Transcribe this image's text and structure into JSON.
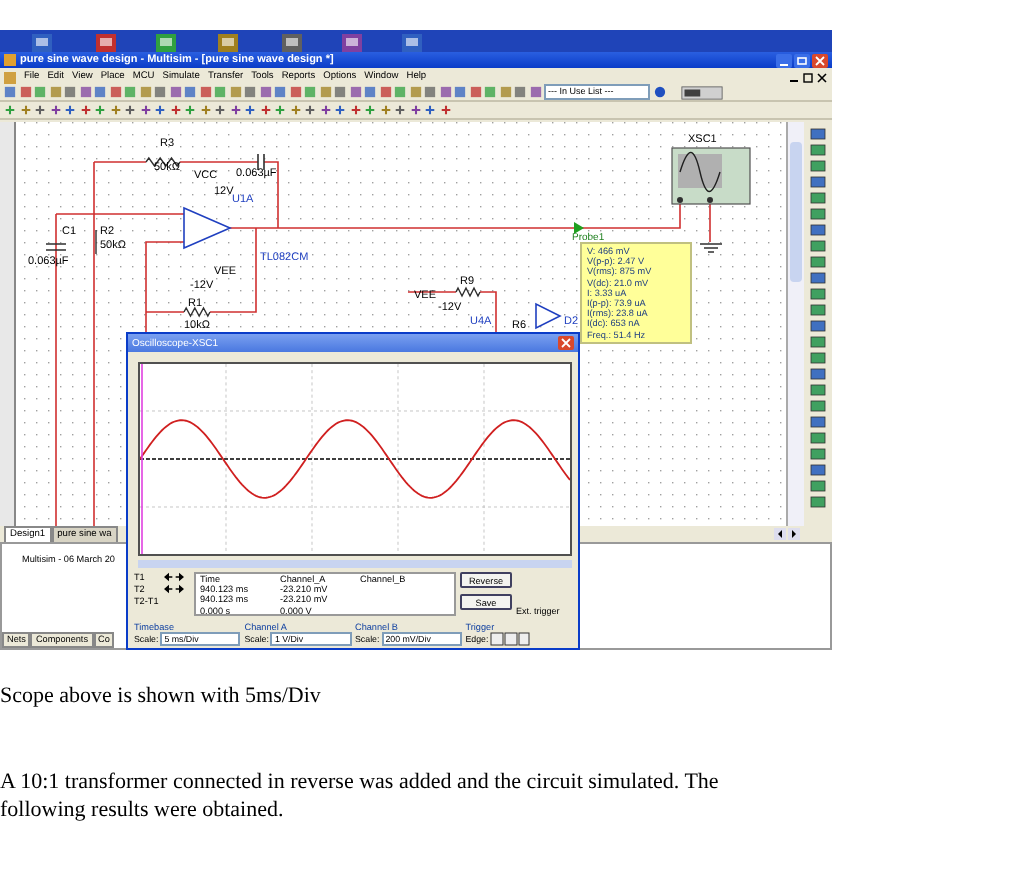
{
  "window": {
    "title": "pure sine wave design - Multisim - [pure sine wave design *]"
  },
  "menu": [
    "File",
    "Edit",
    "View",
    "Place",
    "MCU",
    "Simulate",
    "Transfer",
    "Tools",
    "Reports",
    "Options",
    "Window",
    "Help"
  ],
  "toolbar": {
    "in_use_list": "--- In Use List ---"
  },
  "circuit": {
    "labels": [
      {
        "text": "R3",
        "kind": "ref"
      },
      {
        "text": "50kΩ",
        "kind": "value"
      },
      {
        "text": "0.063µF",
        "kind": "value"
      },
      {
        "text": "VCC",
        "kind": "ref"
      },
      {
        "text": "12V",
        "kind": "value"
      },
      {
        "text": "U1A",
        "kind": "part"
      },
      {
        "text": "C1",
        "kind": "ref"
      },
      {
        "text": "0.063µF",
        "kind": "value"
      },
      {
        "text": "R2",
        "kind": "ref"
      },
      {
        "text": "50kΩ",
        "kind": "value"
      },
      {
        "text": "TL082CM",
        "kind": "part"
      },
      {
        "text": "VEE",
        "kind": "ref"
      },
      {
        "text": "-12V",
        "kind": "value"
      },
      {
        "text": "R1",
        "kind": "ref"
      },
      {
        "text": "10kΩ",
        "kind": "value"
      },
      {
        "text": "VEE",
        "kind": "ref"
      },
      {
        "text": "-12V",
        "kind": "value"
      },
      {
        "text": "R9",
        "kind": "ref"
      },
      {
        "text": "U4A",
        "kind": "part"
      },
      {
        "text": "R6",
        "kind": "ref"
      },
      {
        "text": "D2",
        "kind": "part"
      },
      {
        "text": "XSC1",
        "kind": "ref"
      }
    ]
  },
  "probe": {
    "name": "Probe1",
    "readings": [
      "V: 466 mV",
      "V(p-p): 2.47 V",
      "V(rms): 875 mV",
      "V(dc): 21.0 mV",
      "I: 3.33 uA",
      "I(p-p): 73.9 uA",
      "I(rms): 23.8 uA",
      "I(dc): 653 nA",
      "Freq.: 51.4 Hz"
    ]
  },
  "design_tabs": [
    {
      "label": "Design1",
      "selected": true
    },
    {
      "label": "pure sine wa",
      "selected": false
    }
  ],
  "log": {
    "text": "Multisim  -  06 March 20"
  },
  "panel_tabs": [
    {
      "label": "Nets",
      "selected": false
    },
    {
      "label": "Components",
      "selected": false
    },
    {
      "label": "Co",
      "selected": false
    }
  ],
  "oscilloscope": {
    "title": "Oscilloscope-XSC1",
    "cursor_labels": [
      "T1",
      "T2",
      "T2-T1"
    ],
    "columns": [
      "Time",
      "Channel_A",
      "Channel_B"
    ],
    "rows": [
      [
        "940.123 ms",
        "-23.210 mV",
        ""
      ],
      [
        "940.123 ms",
        "-23.210 mV",
        ""
      ],
      [
        "0.000 s",
        "0.000 V",
        ""
      ]
    ],
    "buttons": [
      "Reverse",
      "Save"
    ],
    "ext_trigger": "Ext. trigger",
    "groups": [
      {
        "title": "Timebase",
        "label": "Scale:",
        "value": "5 ms/Div"
      },
      {
        "title": "Channel A",
        "label": "Scale:",
        "value": "1 V/Div"
      },
      {
        "title": "Channel B",
        "label": "Scale:",
        "value": "200 mV/Div"
      },
      {
        "title": "Trigger",
        "label": "Edge:"
      }
    ]
  },
  "document": {
    "caption": "Scope above is shown with 5ms/Div",
    "paragraph": "A 10:1 transformer connected in reverse was added and the circuit simulated. The following results were obtained."
  }
}
